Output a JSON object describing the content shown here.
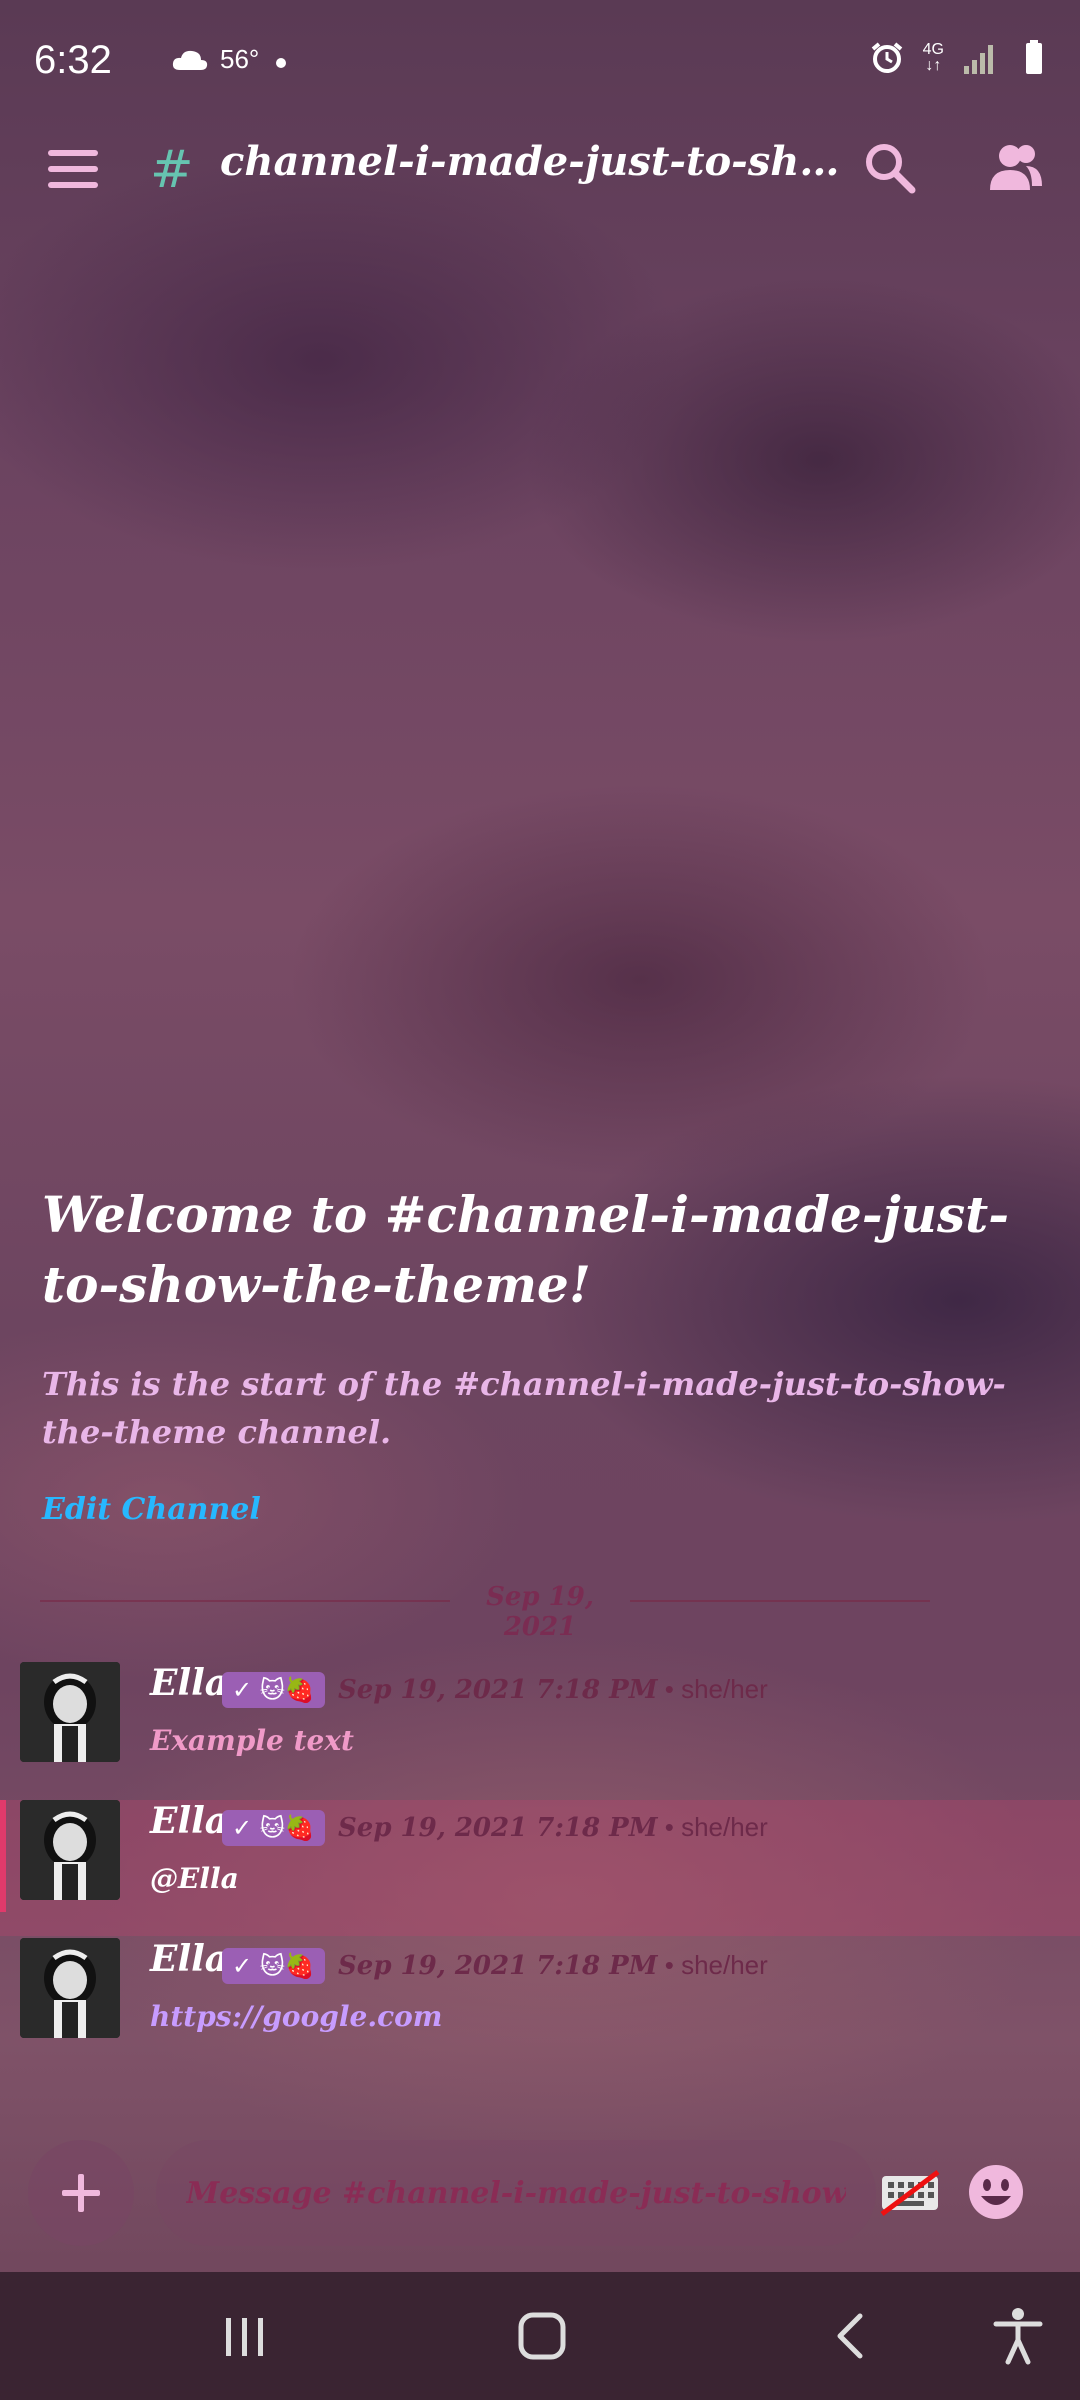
{
  "status_bar": {
    "time": "6:32",
    "temperature": "56°",
    "network": "4G"
  },
  "header": {
    "hash": "#",
    "channel_title": "channel-i-made-just-to-show-th..."
  },
  "welcome": {
    "title": "Welcome to #channel-i-made-just-to-show-the-theme!",
    "subtitle": "This is the start of the #channel-i-made-just-to-show-the-theme channel.",
    "edit_channel": "Edit Channel"
  },
  "date_divider": "Sep 19, 2021",
  "messages": [
    {
      "author": "Ella",
      "badges": "✓ 🐱🍓",
      "timestamp": "Sep 19, 2021 7:18 PM",
      "pronouns": " • she/her",
      "text": "Example text",
      "mentioned": false
    },
    {
      "author": "Ella",
      "badges": "✓ 🐱🍓",
      "timestamp": "Sep 19, 2021 7:18 PM",
      "pronouns": " • she/her",
      "text": "@Ella",
      "mentioned": true
    },
    {
      "author": "Ella",
      "badges": "✓ 🐱🍓",
      "timestamp": "Sep 19, 2021 7:18 PM",
      "pronouns": " • she/her",
      "text": "https://google.com",
      "mentioned": false
    }
  ],
  "composer": {
    "placeholder": "Message #channel-i-made-just-to-show-the-theme"
  },
  "colors": {
    "accent_pink": "#f0b8dd",
    "hash_green": "#66c4b0",
    "link_blue": "#27b8ff",
    "mention_red": "#e03a6b",
    "badge_purple": "#9b5fb4"
  },
  "icons": {
    "menu": "hamburger-icon",
    "search": "search-icon",
    "members": "members-icon",
    "plus": "plus-icon",
    "keyboard": "keyboard-off-icon",
    "emoji": "emoji-icon"
  }
}
